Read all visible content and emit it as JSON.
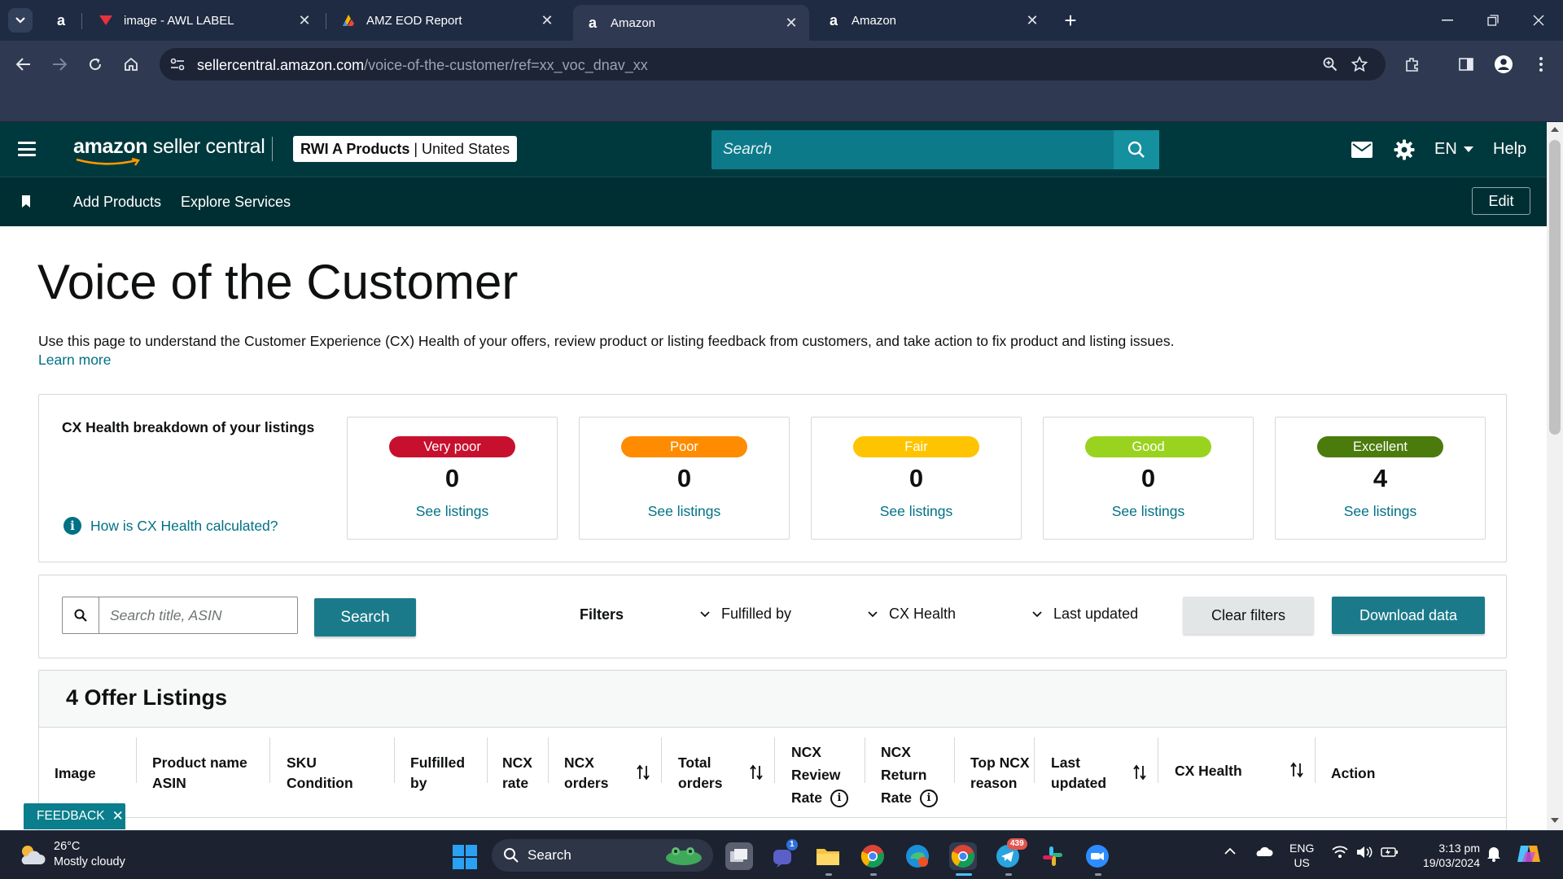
{
  "browser": {
    "tabs": [
      {
        "label": "",
        "favicon": "amazon-a"
      },
      {
        "label": "image - AWL LABEL",
        "favicon": "label-icon"
      },
      {
        "label": "AMZ EOD Report",
        "favicon": "report-icon"
      },
      {
        "label": "Amazon",
        "favicon": "amazon-a",
        "active": true
      },
      {
        "label": "Amazon",
        "favicon": "amazon-a"
      }
    ],
    "url_host": "sellercentral.amazon.com",
    "url_path": "/voice-of-the-customer/ref=xx_voc_dnav_xx"
  },
  "header": {
    "logo_amazon": "amazon",
    "logo_rest": " seller central",
    "store_name": "RWI A Products",
    "marketplace": "United States",
    "search_placeholder": "Search",
    "language": "EN",
    "help": "Help"
  },
  "nav": {
    "links": [
      "Add Products",
      "Explore Services"
    ],
    "edit": "Edit"
  },
  "page": {
    "title": "Voice of the Customer",
    "description": "Use this page to understand the Customer Experience (CX) Health of your offers, review product or listing feedback from customers, and take action to fix product and listing issues.",
    "learn_more": "Learn more"
  },
  "cx_health": {
    "title": "CX Health breakdown of your listings",
    "how_link": "How is CX Health calculated?",
    "cards": [
      {
        "label": "Very poor",
        "count": "0",
        "link": "See listings",
        "color": "#c7102e"
      },
      {
        "label": "Poor",
        "count": "0",
        "link": "See listings",
        "color": "#ff8c00"
      },
      {
        "label": "Fair",
        "count": "0",
        "link": "See listings",
        "color": "#ffc400"
      },
      {
        "label": "Good",
        "count": "0",
        "link": "See listings",
        "color": "#9ad31f"
      },
      {
        "label": "Excellent",
        "count": "4",
        "link": "See listings",
        "color": "#4b7b0c"
      }
    ]
  },
  "filters": {
    "search_placeholder": "Search title, ASIN",
    "search_button": "Search",
    "label": "Filters",
    "dropdowns": [
      "Fulfilled by",
      "CX Health",
      "Last updated"
    ],
    "clear": "Clear filters",
    "download": "Download data"
  },
  "listings": {
    "title": "4 Offer Listings",
    "columns": [
      {
        "lines": [
          "Image"
        ]
      },
      {
        "lines": [
          "Product name",
          "ASIN"
        ]
      },
      {
        "lines": [
          "SKU",
          "Condition"
        ]
      },
      {
        "lines": [
          "Fulfilled",
          "by"
        ]
      },
      {
        "lines": [
          "NCX",
          "rate"
        ]
      },
      {
        "lines": [
          "NCX",
          "orders"
        ]
      },
      {
        "lines": [
          "Total",
          "orders"
        ]
      },
      {
        "lines": [
          "NCX",
          "Review",
          "Rate"
        ]
      },
      {
        "lines": [
          "NCX",
          "Return",
          "Rate"
        ]
      },
      {
        "lines": [
          "Top NCX",
          "reason"
        ]
      },
      {
        "lines": [
          "Last",
          "updated"
        ]
      },
      {
        "lines": [
          "CX Health"
        ]
      },
      {
        "lines": [
          "Action"
        ]
      }
    ]
  },
  "feedback": "FEEDBACK",
  "taskbar": {
    "weather_temp": "26°C",
    "weather_desc": "Mostly cloudy",
    "search": "Search",
    "lang_top": "ENG",
    "lang_bottom": "US",
    "time": "3:13 pm",
    "date": "19/03/2024",
    "telegram_badge": "439",
    "teams_badge": "1"
  }
}
